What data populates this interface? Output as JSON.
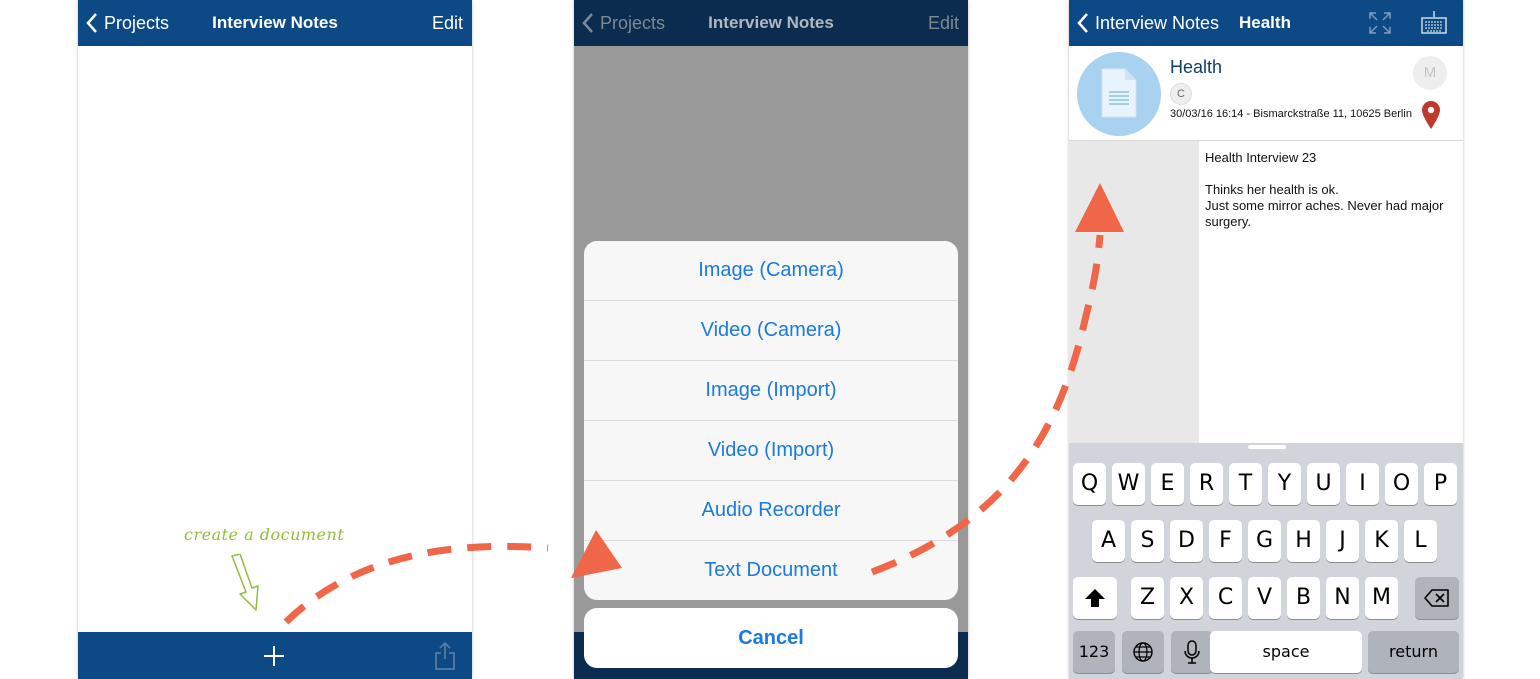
{
  "colors": {
    "navbar": "#0d4a85",
    "action_text": "#1a7ae0",
    "annotation_arrow": "#f06648",
    "hint_green": "#8fbf3c"
  },
  "screen1": {
    "back_label": "Projects",
    "title": "Interview Notes",
    "edit_label": "Edit",
    "hint_text": "create a document",
    "add_icon": "plus-icon",
    "share_icon": "share-icon"
  },
  "screen2": {
    "back_label": "Projects",
    "title": "Interview Notes",
    "edit_label": "Edit",
    "actions": [
      {
        "label": "Image (Camera)"
      },
      {
        "label": "Video (Camera)"
      },
      {
        "label": "Image (Import)"
      },
      {
        "label": "Video (Import)"
      },
      {
        "label": "Audio Recorder"
      },
      {
        "label": "Text Document"
      }
    ],
    "cancel_label": "Cancel"
  },
  "screen3": {
    "back_label": "Interview Notes",
    "title": "Health",
    "doc_title": "Health",
    "badge_letter": "C",
    "meta": "30/03/16 16:14 - Bismarckstraße 11, 10625 Berlin",
    "avatar_letter": "M",
    "note": "Health Interview 23\n\nThinks her health is ok.\nJust some mirror aches. Never had major surgery.",
    "keyboard": {
      "row1": [
        "Q",
        "W",
        "E",
        "R",
        "T",
        "Y",
        "U",
        "I",
        "O",
        "P"
      ],
      "row2": [
        "A",
        "S",
        "D",
        "F",
        "G",
        "H",
        "J",
        "K",
        "L"
      ],
      "row3": [
        "Z",
        "X",
        "C",
        "V",
        "B",
        "N",
        "M"
      ],
      "numbers_label": "123",
      "space_label": "space",
      "return_label": "return"
    }
  }
}
